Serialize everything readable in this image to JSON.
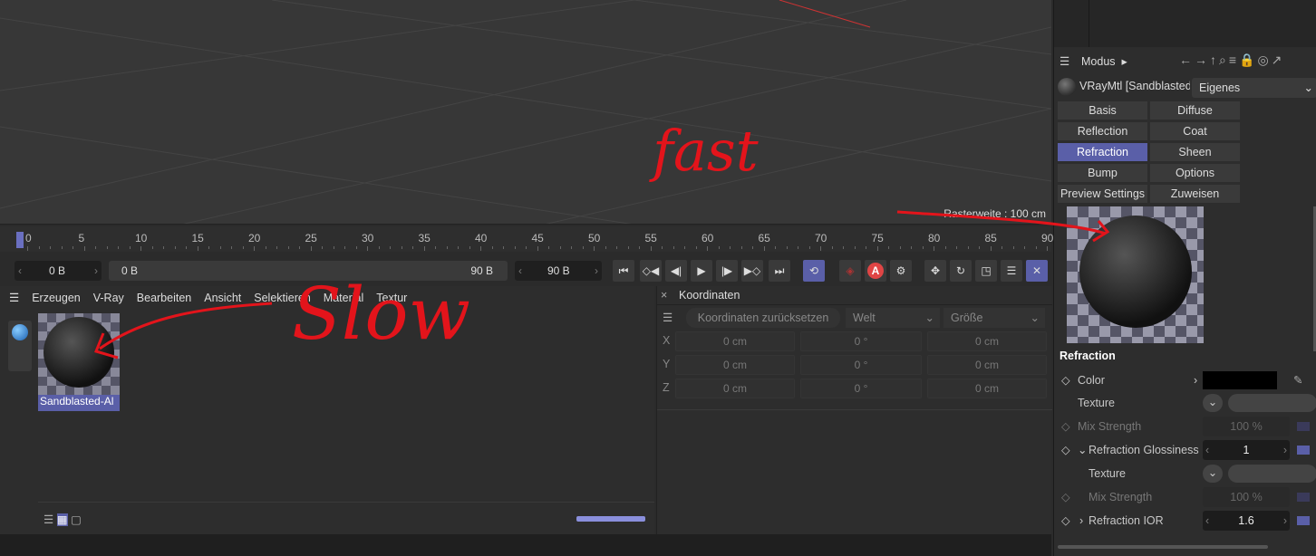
{
  "viewport": {
    "grid_label": "Rasterweite : 100 cm"
  },
  "timeline": {
    "ticks": [
      "0",
      "5",
      "10",
      "15",
      "20",
      "25",
      "30",
      "35",
      "40",
      "45",
      "50",
      "55",
      "60",
      "65",
      "70",
      "75",
      "80",
      "85",
      "90"
    ],
    "current_frame": 0
  },
  "controls": {
    "start": "0 B",
    "range_start": "0 B",
    "range_end": "90 B",
    "end": "90 B",
    "record_label": "A"
  },
  "material_manager": {
    "menu": [
      "Erzeugen",
      "V-Ray",
      "Bearbeiten",
      "Ansicht",
      "Selektieren",
      "Material",
      "Textur"
    ],
    "material_name": "Sandblasted-Al"
  },
  "coordinates": {
    "title": "Koordinaten",
    "reset_button": "Koordinaten zurücksetzen",
    "space": "Welt",
    "mode": "Größe",
    "rows": [
      {
        "axis": "X",
        "pos": "0 cm",
        "rot": "0 °",
        "size": "0 cm"
      },
      {
        "axis": "Y",
        "pos": "0 cm",
        "rot": "0 °",
        "size": "0 cm"
      },
      {
        "axis": "Z",
        "pos": "0 cm",
        "rot": "0 °",
        "size": "0 cm"
      }
    ]
  },
  "attributes": {
    "mode": "Modus",
    "object": "VRayMtl [Sandblasted",
    "preset": "Eigenes",
    "tabs": [
      "Basis",
      "Diffuse",
      "Reflection",
      "Coat",
      "Refraction",
      "Sheen",
      "Bump",
      "Options",
      "Preview Settings",
      "Zuweisen"
    ],
    "active_tab": "Refraction",
    "section": "Refraction",
    "color_label": "Color",
    "color_value": "#000000",
    "texture": "Texture",
    "mix_strength": "Mix Strength",
    "mix_value": "100 %",
    "glossiness_label": "Refraction Glossiness",
    "glossiness_value": "1",
    "ior_label": "Refraction IOR",
    "ior_value": "1.6",
    "accent": "#5a5fa8"
  },
  "annotations": {
    "fast": "fast",
    "slow": "Slow",
    "color": "#e3141b"
  }
}
